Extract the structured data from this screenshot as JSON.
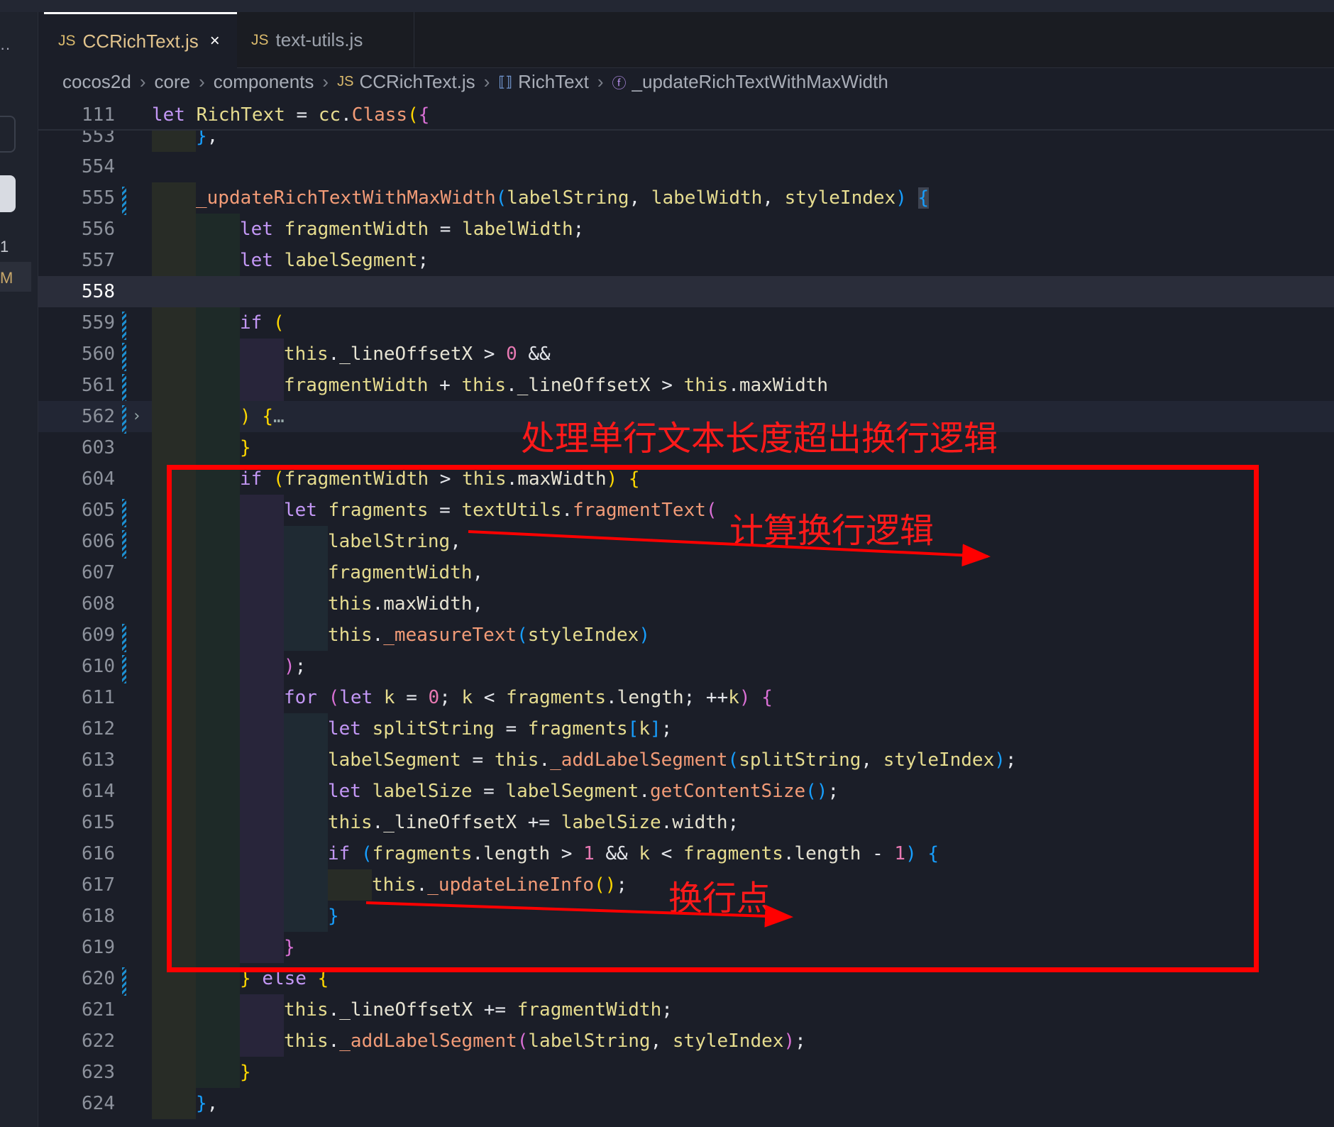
{
  "activity": {
    "badge_count": "1",
    "scm_letter": "M"
  },
  "tabs": [
    {
      "label": "CCRichText.js",
      "icon": "JS",
      "active": true,
      "close": "×"
    },
    {
      "label": "text-utils.js",
      "icon": "JS",
      "active": false
    }
  ],
  "breadcrumb": {
    "items": [
      "cocos2d",
      "core",
      "components",
      "CCRichText.js",
      "RichText",
      "_updateRichTextWithMaxWidth"
    ],
    "file_icon": "JS"
  },
  "sticky": {
    "num": "111",
    "indent": 0,
    "tokens": [
      [
        "kw",
        "let"
      ],
      [
        "op",
        " "
      ],
      [
        "var",
        "RichText"
      ],
      [
        "op",
        " = "
      ],
      [
        "var",
        "cc"
      ],
      [
        "op",
        "."
      ],
      [
        "fn",
        "Class"
      ],
      [
        "b1",
        "("
      ],
      [
        "b2",
        "{"
      ]
    ]
  },
  "lines": [
    {
      "num": "553",
      "indent": 1,
      "tokens": [
        [
          "b3",
          "}"
        ],
        [
          "op",
          ","
        ]
      ]
    },
    {
      "num": "554",
      "indent": 0,
      "tokens": []
    },
    {
      "num": "555",
      "indent": 1,
      "mod": true,
      "tokens": [
        [
          "fn",
          "_updateRichTextWithMaxWidth"
        ],
        [
          "b3",
          "("
        ],
        [
          "var",
          "labelString"
        ],
        [
          "op",
          ", "
        ],
        [
          "var",
          "labelWidth"
        ],
        [
          "op",
          ", "
        ],
        [
          "var",
          "styleIndex"
        ],
        [
          "b3",
          ")"
        ],
        [
          "op",
          " "
        ],
        [
          "b3 mb",
          "{"
        ]
      ]
    },
    {
      "num": "556",
      "indent": 2,
      "tokens": [
        [
          "kw",
          "let"
        ],
        [
          "op",
          " "
        ],
        [
          "var",
          "fragmentWidth"
        ],
        [
          "op",
          " = "
        ],
        [
          "var",
          "labelWidth"
        ],
        [
          "op",
          ";"
        ]
      ]
    },
    {
      "num": "557",
      "indent": 2,
      "tokens": [
        [
          "kw",
          "let"
        ],
        [
          "op",
          " "
        ],
        [
          "var",
          "labelSegment"
        ],
        [
          "op",
          ";"
        ]
      ]
    },
    {
      "num": "558",
      "indent": 0,
      "cur": true,
      "tokens": []
    },
    {
      "num": "559",
      "indent": 2,
      "mod": true,
      "tokens": [
        [
          "kw",
          "if"
        ],
        [
          "op",
          " "
        ],
        [
          "b1",
          "("
        ]
      ]
    },
    {
      "num": "560",
      "indent": 3,
      "mod": true,
      "tokens": [
        [
          "var",
          "this"
        ],
        [
          "op",
          "."
        ],
        [
          "prop",
          "_lineOffsetX"
        ],
        [
          "op",
          " > "
        ],
        [
          "num",
          "0"
        ],
        [
          "op",
          " &&"
        ]
      ]
    },
    {
      "num": "561",
      "indent": 3,
      "mod": true,
      "tokens": [
        [
          "var",
          "fragmentWidth"
        ],
        [
          "op",
          " + "
        ],
        [
          "var",
          "this"
        ],
        [
          "op",
          "."
        ],
        [
          "prop",
          "_lineOffsetX"
        ],
        [
          "op",
          " > "
        ],
        [
          "var",
          "this"
        ],
        [
          "op",
          "."
        ],
        [
          "prop",
          "maxWidth"
        ]
      ]
    },
    {
      "num": "562",
      "indent": 2,
      "mod": true,
      "fold": true,
      "tokens": [
        [
          "b1",
          ")"
        ],
        [
          "op",
          " "
        ],
        [
          "b1",
          "{"
        ],
        [
          "dots2",
          "…"
        ]
      ]
    },
    {
      "num": "603",
      "indent": 2,
      "tokens": [
        [
          "b1",
          "}"
        ]
      ]
    },
    {
      "num": "604",
      "indent": 2,
      "tokens": [
        [
          "kw",
          "if"
        ],
        [
          "op",
          " "
        ],
        [
          "b1",
          "("
        ],
        [
          "var",
          "fragmentWidth"
        ],
        [
          "op",
          " > "
        ],
        [
          "var",
          "this"
        ],
        [
          "op",
          "."
        ],
        [
          "prop",
          "maxWidth"
        ],
        [
          "b1",
          ")"
        ],
        [
          "op",
          " "
        ],
        [
          "b1",
          "{"
        ]
      ]
    },
    {
      "num": "605",
      "indent": 3,
      "mod": true,
      "tokens": [
        [
          "kw",
          "let"
        ],
        [
          "op",
          " "
        ],
        [
          "var",
          "fragments"
        ],
        [
          "op",
          " = "
        ],
        [
          "var",
          "textUtils"
        ],
        [
          "op",
          "."
        ],
        [
          "fn",
          "fragmentText"
        ],
        [
          "b2",
          "("
        ]
      ]
    },
    {
      "num": "606",
      "indent": 4,
      "mod": true,
      "tokens": [
        [
          "var",
          "labelString"
        ],
        [
          "op",
          ","
        ]
      ]
    },
    {
      "num": "607",
      "indent": 4,
      "tokens": [
        [
          "var",
          "fragmentWidth"
        ],
        [
          "op",
          ","
        ]
      ]
    },
    {
      "num": "608",
      "indent": 4,
      "tokens": [
        [
          "var",
          "this"
        ],
        [
          "op",
          "."
        ],
        [
          "prop",
          "maxWidth"
        ],
        [
          "op",
          ","
        ]
      ]
    },
    {
      "num": "609",
      "indent": 4,
      "mod": true,
      "tokens": [
        [
          "var",
          "this"
        ],
        [
          "op",
          "."
        ],
        [
          "fn",
          "_measureText"
        ],
        [
          "b3",
          "("
        ],
        [
          "var",
          "styleIndex"
        ],
        [
          "b3",
          ")"
        ]
      ]
    },
    {
      "num": "610",
      "indent": 3,
      "mod": true,
      "tokens": [
        [
          "b2",
          ")"
        ],
        [
          "op",
          ";"
        ]
      ]
    },
    {
      "num": "611",
      "indent": 3,
      "tokens": [
        [
          "kw",
          "for"
        ],
        [
          "op",
          " "
        ],
        [
          "b2",
          "("
        ],
        [
          "kw",
          "let"
        ],
        [
          "op",
          " "
        ],
        [
          "var",
          "k"
        ],
        [
          "op",
          " = "
        ],
        [
          "num",
          "0"
        ],
        [
          "op",
          "; "
        ],
        [
          "var",
          "k"
        ],
        [
          "op",
          " < "
        ],
        [
          "var",
          "fragments"
        ],
        [
          "op",
          "."
        ],
        [
          "prop",
          "length"
        ],
        [
          "op",
          "; ++"
        ],
        [
          "var",
          "k"
        ],
        [
          "b2",
          ")"
        ],
        [
          "op",
          " "
        ],
        [
          "b2",
          "{"
        ]
      ]
    },
    {
      "num": "612",
      "indent": 4,
      "tokens": [
        [
          "kw",
          "let"
        ],
        [
          "op",
          " "
        ],
        [
          "var",
          "splitString"
        ],
        [
          "op",
          " = "
        ],
        [
          "var",
          "fragments"
        ],
        [
          "b3",
          "["
        ],
        [
          "var",
          "k"
        ],
        [
          "b3",
          "]"
        ],
        [
          "op",
          ";"
        ]
      ]
    },
    {
      "num": "613",
      "indent": 4,
      "tokens": [
        [
          "var",
          "labelSegment"
        ],
        [
          "op",
          " = "
        ],
        [
          "var",
          "this"
        ],
        [
          "op",
          "."
        ],
        [
          "fn",
          "_addLabelSegment"
        ],
        [
          "b3",
          "("
        ],
        [
          "var",
          "splitString"
        ],
        [
          "op",
          ", "
        ],
        [
          "var",
          "styleIndex"
        ],
        [
          "b3",
          ")"
        ],
        [
          "op",
          ";"
        ]
      ]
    },
    {
      "num": "614",
      "indent": 4,
      "tokens": [
        [
          "kw",
          "let"
        ],
        [
          "op",
          " "
        ],
        [
          "var",
          "labelSize"
        ],
        [
          "op",
          " = "
        ],
        [
          "var",
          "labelSegment"
        ],
        [
          "op",
          "."
        ],
        [
          "fn",
          "getContentSize"
        ],
        [
          "b3",
          "()"
        ],
        [
          "op",
          ";"
        ]
      ]
    },
    {
      "num": "615",
      "indent": 4,
      "tokens": [
        [
          "var",
          "this"
        ],
        [
          "op",
          "."
        ],
        [
          "prop",
          "_lineOffsetX"
        ],
        [
          "op",
          " += "
        ],
        [
          "var",
          "labelSize"
        ],
        [
          "op",
          "."
        ],
        [
          "prop",
          "width"
        ],
        [
          "op",
          ";"
        ]
      ]
    },
    {
      "num": "616",
      "indent": 4,
      "tokens": [
        [
          "kw",
          "if"
        ],
        [
          "op",
          " "
        ],
        [
          "b3",
          "("
        ],
        [
          "var",
          "fragments"
        ],
        [
          "op",
          "."
        ],
        [
          "prop",
          "length"
        ],
        [
          "op",
          " > "
        ],
        [
          "num",
          "1"
        ],
        [
          "op",
          " && "
        ],
        [
          "var",
          "k"
        ],
        [
          "op",
          " < "
        ],
        [
          "var",
          "fragments"
        ],
        [
          "op",
          "."
        ],
        [
          "prop",
          "length"
        ],
        [
          "op",
          " - "
        ],
        [
          "num",
          "1"
        ],
        [
          "b3",
          ")"
        ],
        [
          "op",
          " "
        ],
        [
          "b3",
          "{"
        ]
      ]
    },
    {
      "num": "617",
      "indent": 5,
      "tokens": [
        [
          "var",
          "this"
        ],
        [
          "op",
          "."
        ],
        [
          "fn",
          "_updateLineInfo"
        ],
        [
          "b1",
          "()"
        ],
        [
          "op",
          ";"
        ]
      ]
    },
    {
      "num": "618",
      "indent": 4,
      "tokens": [
        [
          "b3",
          "}"
        ]
      ]
    },
    {
      "num": "619",
      "indent": 3,
      "tokens": [
        [
          "b2",
          "}"
        ]
      ]
    },
    {
      "num": "620",
      "indent": 2,
      "mod": true,
      "tokens": [
        [
          "b1",
          "}"
        ],
        [
          "op",
          " "
        ],
        [
          "kw",
          "else"
        ],
        [
          "op",
          " "
        ],
        [
          "b1",
          "{"
        ]
      ]
    },
    {
      "num": "621",
      "indent": 3,
      "tokens": [
        [
          "var",
          "this"
        ],
        [
          "op",
          "."
        ],
        [
          "prop",
          "_lineOffsetX"
        ],
        [
          "op",
          " += "
        ],
        [
          "var",
          "fragmentWidth"
        ],
        [
          "op",
          ";"
        ]
      ]
    },
    {
      "num": "622",
      "indent": 3,
      "tokens": [
        [
          "var",
          "this"
        ],
        [
          "op",
          "."
        ],
        [
          "fn",
          "_addLabelSegment"
        ],
        [
          "b2",
          "("
        ],
        [
          "var",
          "labelString"
        ],
        [
          "op",
          ", "
        ],
        [
          "var",
          "styleIndex"
        ],
        [
          "b2",
          ")"
        ],
        [
          "op",
          ";"
        ]
      ]
    },
    {
      "num": "623",
      "indent": 2,
      "tokens": [
        [
          "b1",
          "}"
        ]
      ]
    },
    {
      "num": "624",
      "indent": 1,
      "tokens": [
        [
          "b3",
          "}"
        ],
        [
          "op",
          ","
        ]
      ]
    }
  ],
  "annotations": {
    "title": "处理单行文本长度超出换行逻辑",
    "calc": "计算换行逻辑",
    "break_point": "换行点",
    "color": "#ff0000"
  }
}
